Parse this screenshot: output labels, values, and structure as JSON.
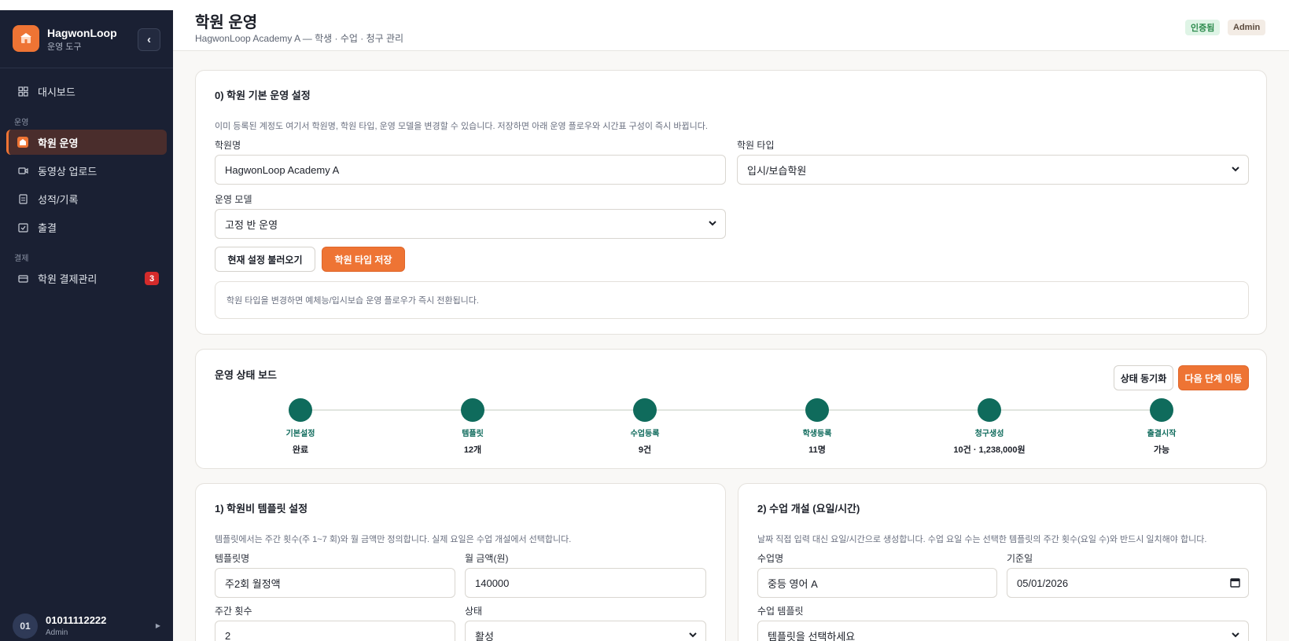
{
  "sidebar": {
    "brand_title": "HagwonLoop",
    "brand_sub": "운영 도구",
    "collapse_icon": "chevron-left-icon",
    "nav_dashboard": "대시보드",
    "section_operations": "운영",
    "nav_academy_ops": "학원 운영",
    "nav_video_upload": "동영상 업로드",
    "nav_grades": "성적/기록",
    "nav_attendance": "출결",
    "section_payments": "결제",
    "nav_payment_mgmt": "학원 결제관리",
    "payment_badge": "3",
    "user_avatar": "01",
    "user_name": "01011112222",
    "user_role": "Admin"
  },
  "header": {
    "title": "학원 운영",
    "subtitle": "HagwonLoop Academy A — 학생 · 수업 · 청구 관리",
    "badge_verified": "인증됨",
    "badge_admin": "Admin"
  },
  "basic_settings": {
    "title": "0) 학원 기본 운영 설정",
    "desc": "이미 등록된 계정도 여기서 학원명, 학원 타입, 운영 모델을 변경할 수 있습니다. 저장하면 아래 운영 플로우와 시간표 구성이 즉시 바뀝니다.",
    "name_label": "학원명",
    "name_value": "HagwonLoop Academy A",
    "type_label": "학원 타입",
    "type_value": "입시/보습학원",
    "model_label": "운영 모델",
    "model_value": "고정 반 운영",
    "load_button": "현재 설정 불러오기",
    "save_button": "학원 타입 저장",
    "notice": "학원 타입을 변경하면 예체능/입시보습 운영 플로우가 즉시 전환됩니다."
  },
  "status_board": {
    "title": "운영 상태 보드",
    "sync_button": "상태 동기화",
    "next_button": "다음 단계 이동",
    "steps": [
      {
        "label": "기본설정",
        "value": "완료"
      },
      {
        "label": "템플릿",
        "value": "12개"
      },
      {
        "label": "수업등록",
        "value": "9건"
      },
      {
        "label": "학생등록",
        "value": "11명"
      },
      {
        "label": "청구생성",
        "value": "10건 · 1,238,000원"
      },
      {
        "label": "출결시작",
        "value": "가능"
      }
    ]
  },
  "template_settings": {
    "title": "1) 학원비 템플릿 설정",
    "desc": "템플릿에서는 주간 횟수(주 1~7 회)와 월 금액만 정의합니다. 실제 요일은 수업 개설에서 선택합니다.",
    "name_label": "템플릿명",
    "name_value": "주2회 월정액",
    "amount_label": "월 금액(원)",
    "amount_value": "140000",
    "weekly_label": "주간 횟수",
    "weekly_value": "2",
    "status_label": "상태",
    "status_value": "활성"
  },
  "class_open": {
    "title": "2) 수업 개설 (요일/시간)",
    "desc": "날짜 직접 입력 대신 요일/시간으로 생성합니다. 수업 요일 수는 선택한 템플릿의 주간 횟수(요일 수)와 반드시 일치해야 합니다.",
    "class_name_label": "수업명",
    "class_name_value": "중등 영어 A",
    "base_date_label": "기준일",
    "base_date_value": "05/01/2026",
    "template_label": "수업 템플릿",
    "template_value": "템플릿을 선택하세요"
  },
  "colors": {
    "accent": "#ee7434",
    "sidebar_bg": "#1a2033",
    "step_done": "#0f6b5c",
    "badge_red": "#d42b2b"
  }
}
